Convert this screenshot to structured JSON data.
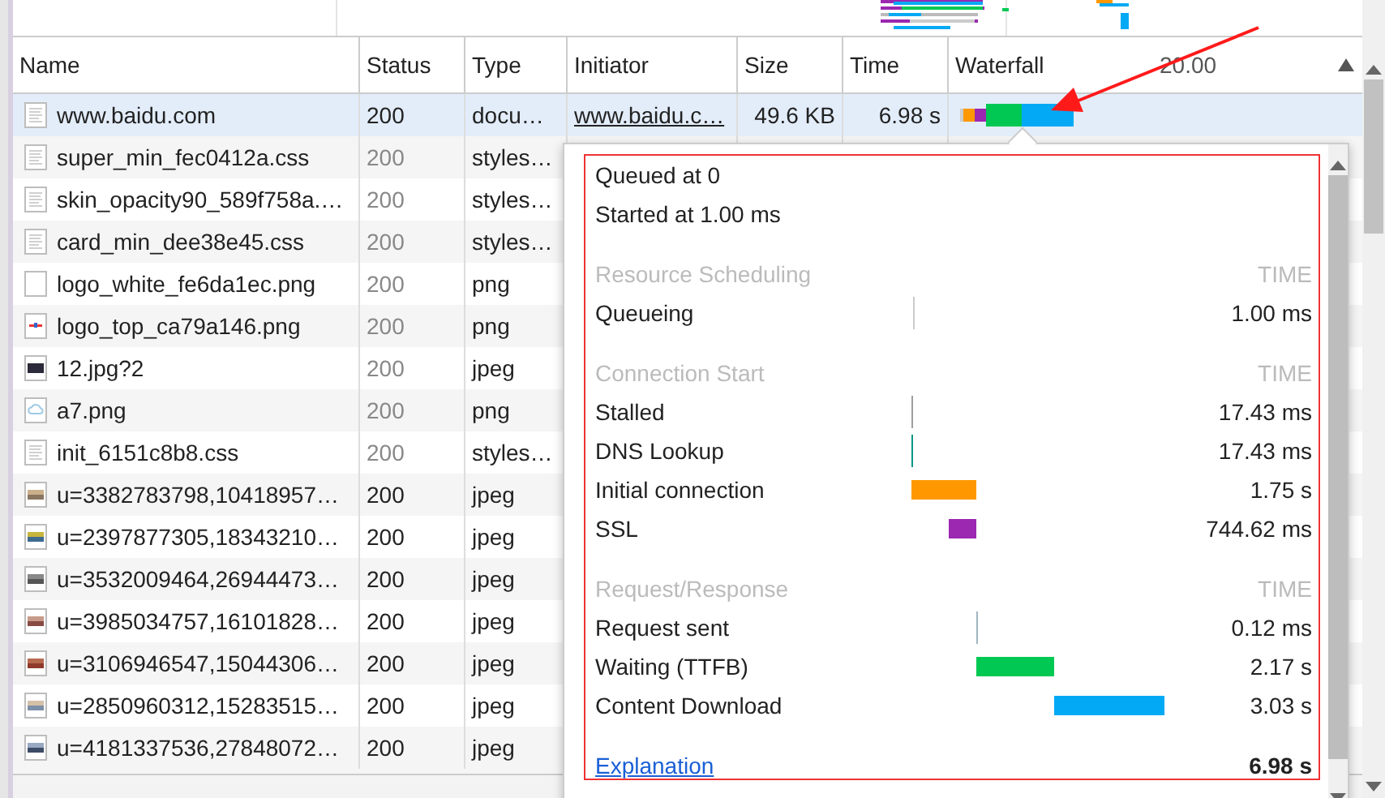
{
  "columns": [
    {
      "label": "Name"
    },
    {
      "label": "Status"
    },
    {
      "label": "Type"
    },
    {
      "label": "Initiator"
    },
    {
      "label": "Size"
    },
    {
      "label": "Time"
    },
    {
      "label": "Waterfall"
    }
  ],
  "waterfall_tick": "20.00",
  "rows": [
    {
      "name": "www.baidu.com",
      "kind": "document",
      "status": "200",
      "cached": false,
      "type": "docu…",
      "initiator": "www.baidu.c…",
      "size": "49.6 KB",
      "time": "6.98 s",
      "selected": true
    },
    {
      "name": "super_min_fec0412a.css",
      "kind": "document",
      "status": "200",
      "cached": true,
      "type": "styles…",
      "selected": false
    },
    {
      "name": "skin_opacity90_589f758a.…",
      "kind": "document",
      "status": "200",
      "cached": true,
      "type": "styles…",
      "selected": false
    },
    {
      "name": "card_min_dee38e45.css",
      "kind": "document",
      "status": "200",
      "cached": true,
      "type": "styles…",
      "selected": false
    },
    {
      "name": "logo_white_fe6da1ec.png",
      "kind": "blank",
      "status": "200",
      "cached": true,
      "type": "png",
      "selected": false
    },
    {
      "name": "logo_top_ca79a146.png",
      "kind": "logo",
      "status": "200",
      "cached": true,
      "type": "png",
      "selected": false
    },
    {
      "name": "12.jpg?2",
      "kind": "dark",
      "status": "200",
      "cached": true,
      "type": "jpeg",
      "selected": false
    },
    {
      "name": "a7.png",
      "kind": "cloud",
      "status": "200",
      "cached": true,
      "type": "png",
      "selected": false
    },
    {
      "name": "init_6151c8b8.css",
      "kind": "document",
      "status": "200",
      "cached": true,
      "type": "styles…",
      "selected": false
    },
    {
      "name": "u=3382783798,10418957…",
      "kind": "photo",
      "status": "200",
      "cached": false,
      "type": "jpeg",
      "selected": false
    },
    {
      "name": "u=2397877305,18343210…",
      "kind": "photo",
      "status": "200",
      "cached": false,
      "type": "jpeg",
      "selected": false
    },
    {
      "name": "u=3532009464,26944473…",
      "kind": "photo",
      "status": "200",
      "cached": false,
      "type": "jpeg",
      "selected": false
    },
    {
      "name": "u=3985034757,16101828…",
      "kind": "photo",
      "status": "200",
      "cached": false,
      "type": "jpeg",
      "selected": false
    },
    {
      "name": "u=3106946547,15044306…",
      "kind": "photo",
      "status": "200",
      "cached": false,
      "type": "jpeg",
      "selected": false
    },
    {
      "name": "u=2850960312,15283515…",
      "kind": "photo",
      "status": "200",
      "cached": false,
      "type": "jpeg",
      "selected": false
    },
    {
      "name": "u=4181337536,27848072…",
      "kind": "photo",
      "status": "200",
      "cached": false,
      "type": "jpeg",
      "selected": false
    }
  ],
  "timing": {
    "queued": "Queued at 0",
    "started": "Started at 1.00 ms",
    "sections": [
      {
        "title": "Resource Scheduling",
        "time_label": "TIME",
        "rows": [
          {
            "label": "Queueing",
            "kind": "tick",
            "color": "#cccccc",
            "value": "1.00 ms"
          }
        ]
      },
      {
        "title": "Connection Start",
        "time_label": "TIME",
        "rows": [
          {
            "label": "Stalled",
            "kind": "tick",
            "color": "#9e9e9e",
            "value": "17.43 ms"
          },
          {
            "label": "DNS Lookup",
            "kind": "tick",
            "color": "#009688",
            "value": "17.43 ms"
          },
          {
            "label": "Initial connection",
            "kind": "bar",
            "color": "#ff9800",
            "value": "1.75 s"
          },
          {
            "label": "SSL",
            "kind": "bar",
            "color": "#9c27b0",
            "value": "744.62 ms"
          }
        ]
      },
      {
        "title": "Request/Response",
        "time_label": "TIME",
        "rows": [
          {
            "label": "Request sent",
            "kind": "tick",
            "color": "#9eb5bf",
            "value": "0.12 ms"
          },
          {
            "label": "Waiting (TTFB)",
            "kind": "bar",
            "color": "#00c853",
            "value": "2.17 s"
          },
          {
            "label": "Content Download",
            "kind": "bar",
            "color": "#03a9f4",
            "value": "3.03 s"
          }
        ]
      }
    ],
    "explanation": "Explanation",
    "total": "6.98 s"
  }
}
